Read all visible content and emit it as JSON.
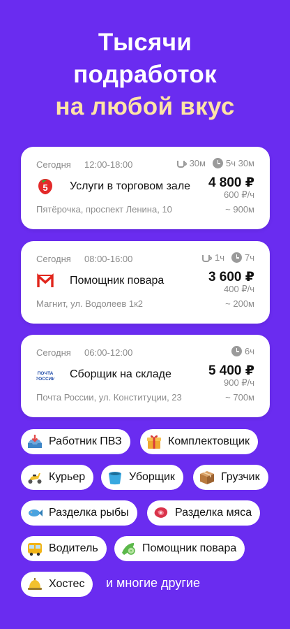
{
  "headline": {
    "line1": "Тысячи",
    "line2": "подработок",
    "line3": "на любой вкус"
  },
  "colors": {
    "background": "#6a2cf0",
    "accent_headline": "#ffe3a6",
    "card": "#ffffff",
    "muted_text": "#8c8c8c"
  },
  "jobs": [
    {
      "date": "Сегодня",
      "time": "12:00-18:00",
      "break": "30м",
      "duration": "5ч 30м",
      "title": "Услуги в торговом зале",
      "price": "4 800 ₽",
      "rate": "600 ₽/ч",
      "address": "Пятёрочка, проспект Ленина, 10",
      "distance": "~ 900м",
      "logo": "pyaterochka-logo"
    },
    {
      "date": "Сегодня",
      "time": "08:00-16:00",
      "break": "1ч",
      "duration": "7ч",
      "title": "Помощник повара",
      "price": "3 600 ₽",
      "rate": "400 ₽/ч",
      "address": "Магнит, ул. Водолеев 1к2",
      "distance": "~ 200м",
      "logo": "magnit-logo"
    },
    {
      "date": "Сегодня",
      "time": "06:00-12:00",
      "duration": "6ч",
      "title": "Сборщик на складе",
      "price": "5 400 ₽",
      "rate": "900 ₽/ч",
      "address": "Почта России, ул. Конституции, 23",
      "distance": "~ 700м",
      "logo": "pochta-rossii-logo",
      "logo_text": "ПОЧТА РОССИИ"
    }
  ],
  "categories": [
    {
      "label": "Работник ПВЗ",
      "icon": "inbox-tray-icon"
    },
    {
      "label": "Комплектовщик",
      "icon": "gift-box-icon"
    },
    {
      "label": "Курьер",
      "icon": "scooter-icon"
    },
    {
      "label": "Уборщик",
      "icon": "bucket-icon"
    },
    {
      "label": "Грузчик",
      "icon": "package-icon"
    },
    {
      "label": "Разделка рыбы",
      "icon": "fish-icon"
    },
    {
      "label": "Разделка мяса",
      "icon": "meat-icon"
    },
    {
      "label": "Водитель",
      "icon": "bus-icon"
    },
    {
      "label": "Помощник повара",
      "icon": "cucumber-icon"
    },
    {
      "label": "Хостес",
      "icon": "bellhop-bell-icon"
    }
  ],
  "tail_text": "и многие другие"
}
